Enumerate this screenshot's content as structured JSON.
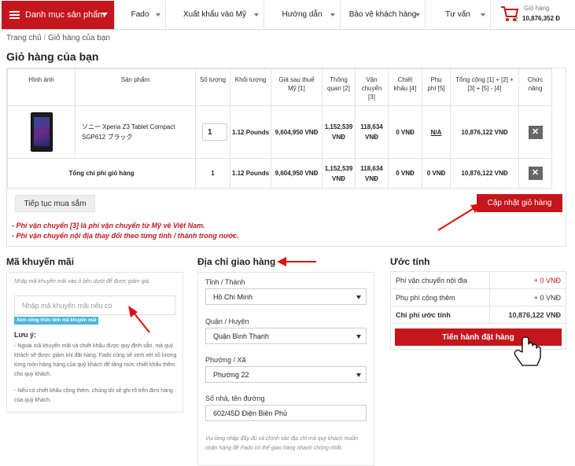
{
  "nav": {
    "category_label": "Danh mục sản phẩm",
    "items": [
      "Fado",
      "Xuất khẩu vào Mỹ",
      "Hướng dẫn",
      "Bảo vệ khách hàng",
      "Tư vấn"
    ],
    "cart_label": "Giỏ hàng",
    "cart_count": "2",
    "cart_total": "10,876,352 Đ"
  },
  "breadcrumb": {
    "home": "Trang chủ",
    "sep": "/",
    "current": "Giỏ hàng của bạn"
  },
  "page_title": "Giỏ hàng của bạn",
  "cart": {
    "headers": {
      "image": "Hình ảnh",
      "product": "Sản phẩm",
      "quantity": "Số lượng",
      "weight": "Khối lượng",
      "price": "Giá sau thuế Mỹ [1]",
      "customs": "Thông quan [2]",
      "shipping": "Vận chuyển [3]",
      "discount": "Chiết khấu [4]",
      "surcharge": "Phụ phí [5]",
      "total": "Tổng cộng [1] + [2] + [3] + [5] - [4]",
      "function": "Chức năng"
    },
    "item": {
      "name_line1": "ソニー Xperia Z3 Tablet Compact",
      "name_line2": "SGP612 ブラック",
      "quantity": "1",
      "weight": "1.12 Pounds",
      "price": "9,604,950 VNĐ",
      "customs": "1,152,539 VNĐ",
      "shipping": "118,634 VNĐ",
      "discount": "0 VNĐ",
      "surcharge": "N/A",
      "total": "10,876,122 VNĐ",
      "remove": "✕"
    },
    "summary": {
      "label": "Tổng chi phí giỏ hàng",
      "quantity": "1",
      "weight": "1.12 Pounds",
      "price": "9,604,950 VNĐ",
      "customs": "1,152,539 VNĐ",
      "shipping": "118,634 VNĐ",
      "discount": "0 VNĐ",
      "surcharge": "0 VNĐ",
      "total": "10,876,122 VNĐ",
      "remove": "✕"
    },
    "continue_label": "Tiếp tục mua sắm",
    "update_label": "Cập nhật giỏ hàng",
    "note1": "- Phí vận chuyển [3] là phí vận chuyển từ Mỹ về Việt Nam.",
    "note2": "- Phí vận chuyển nội địa thay đổi theo từng tỉnh / thành trong nước."
  },
  "promo": {
    "title": "Mã khuyến mãi",
    "hint": "Nhập mã khuyến mãi vào ô bên dưới để được giảm giá.",
    "placeholder": "Nhập mã khuyến mãi nếu có",
    "formula_link": "Xem công thức tính mã khuyến mãi",
    "note_title": "Lưu ý:",
    "note_text": "- Ngoài mã khuyến mãi và chiết khấu được quy định sẵn, mà quý khách sẽ được giảm khi đặt hàng. Fado cũng sẽ xem xét số lượng từng món hàng hàng của quý khách để tăng mức chiết khấu thêm cho quý khách.",
    "note_text2": "- Nếu có chiết khấu cộng thêm, chúng tôi sẽ ghi rõ trên đơn hàng của quý khách."
  },
  "address": {
    "title": "Địa chỉ giao hàng",
    "city_label": "Tỉnh / Thành",
    "city_value": "Hồ Chí Minh",
    "district_label": "Quận / Huyện",
    "district_value": "Quận Bình Thạnh",
    "ward_label": "Phường / Xã",
    "ward_value": "Phường 22",
    "street_label": "Số nhà, tên đường",
    "street_value": "602/45D Điện Biên Phủ",
    "hint": "Vui lòng nhập đầy đủ và chính xác địa chỉ mà quý khách muốn nhận hàng để Fado có thể giao hàng nhanh chóng nhất."
  },
  "estimate": {
    "title": "Ước tính",
    "rows": [
      {
        "label": "Phí vận chuyển nội địa",
        "value": "+ 0 VNĐ"
      },
      {
        "label": "Phụ phí cộng thêm",
        "value": "+ 0 VNĐ"
      },
      {
        "label": "Chi phí ước tính",
        "value": "10,876,122 VNĐ"
      }
    ],
    "checkout_label": "Tiến hành đặt hàng"
  },
  "colors": {
    "brand_red": "#c4161c",
    "link_blue": "#4cb6d9"
  }
}
